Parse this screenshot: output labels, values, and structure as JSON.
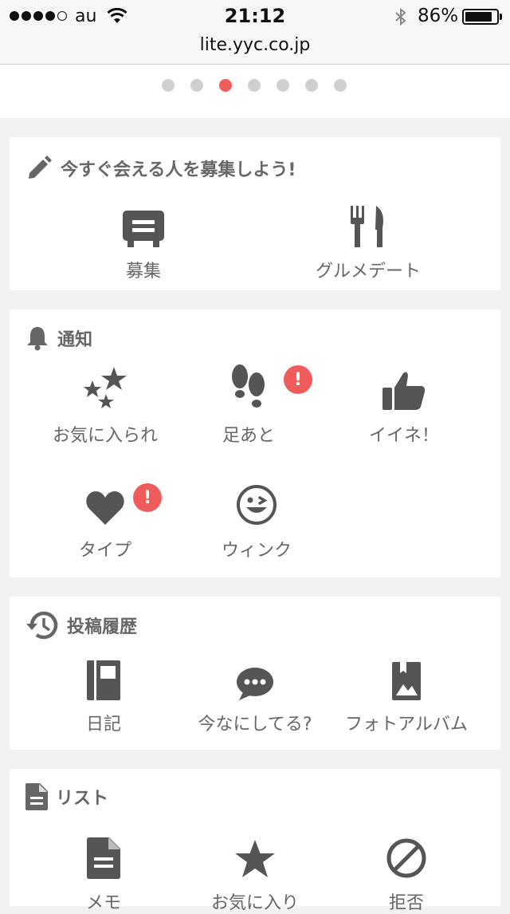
{
  "status_bar": {
    "carrier": "au",
    "time": "21:12",
    "battery": "86%",
    "battery_level": 0.86,
    "url": "lite.yyc.co.jp"
  },
  "carousel": {
    "pages": 7,
    "active_index": 2
  },
  "recruit": {
    "title": "今すぐ会える人を募集しよう!",
    "items": [
      {
        "label": "募集",
        "icon": "board-icon"
      },
      {
        "label": "グルメデート",
        "icon": "fork-knife-icon"
      }
    ]
  },
  "notifications": {
    "title": "通知",
    "badge_text": "!",
    "items": [
      {
        "label": "お気に入られ",
        "icon": "stars-icon"
      },
      {
        "label": "足あと",
        "icon": "footprints-icon",
        "badge": true
      },
      {
        "label": "イイネ！",
        "icon": "thumbs-up-icon"
      },
      {
        "label": "タイプ",
        "icon": "heart-icon",
        "badge": true
      },
      {
        "label": "ウィンク",
        "icon": "wink-face-icon"
      }
    ]
  },
  "history": {
    "title": "投稿履歴",
    "items": [
      {
        "label": "日記",
        "icon": "notebook-icon"
      },
      {
        "label": "今なにしてる?",
        "icon": "chat-bubble-icon"
      },
      {
        "label": "フォトアルバム",
        "icon": "photo-album-icon"
      }
    ]
  },
  "lists": {
    "title": "リスト",
    "items": [
      {
        "label": "メモ",
        "icon": "memo-icon"
      },
      {
        "label": "お気に入り",
        "icon": "star-icon"
      },
      {
        "label": "拒否",
        "icon": "block-icon"
      }
    ]
  },
  "colors": {
    "accent": "#f05b5b",
    "icon": "#555555",
    "background": "#f2f2f2"
  }
}
